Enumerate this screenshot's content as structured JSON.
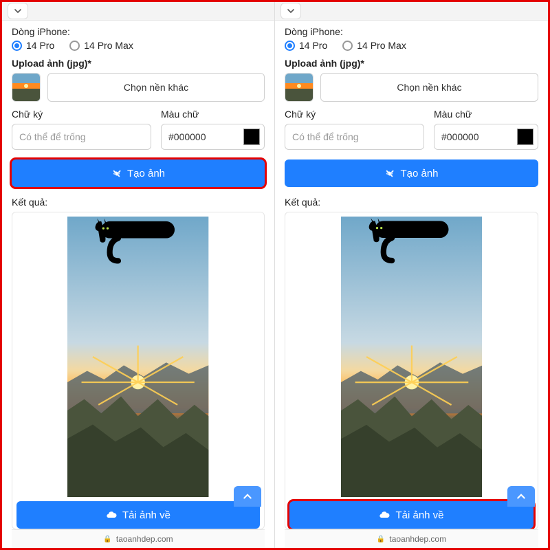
{
  "panels": [
    {
      "highlightCreate": true,
      "highlightDownload": false
    },
    {
      "highlightCreate": false,
      "highlightDownload": true
    }
  ],
  "form": {
    "modelLabel": "Dòng iPhone:",
    "option1": "14 Pro",
    "option2": "14 Pro Max",
    "uploadLabel": "Upload ảnh (jpg)*",
    "chooseBg": "Chọn nền khác",
    "sigLabel": "Chữ ký",
    "sigPlaceholder": "Có thể để trống",
    "colorLabel": "Màu chữ",
    "colorValue": "#000000",
    "createBtn": "Tạo ảnh",
    "resultLabel": "Kết quả:",
    "downloadBtn": "Tải ảnh về"
  },
  "footer": {
    "domain": "taoanhdep.com"
  },
  "colors": {
    "primary": "#1f7fff",
    "highlight": "#e40000",
    "swatch": "#000000"
  }
}
